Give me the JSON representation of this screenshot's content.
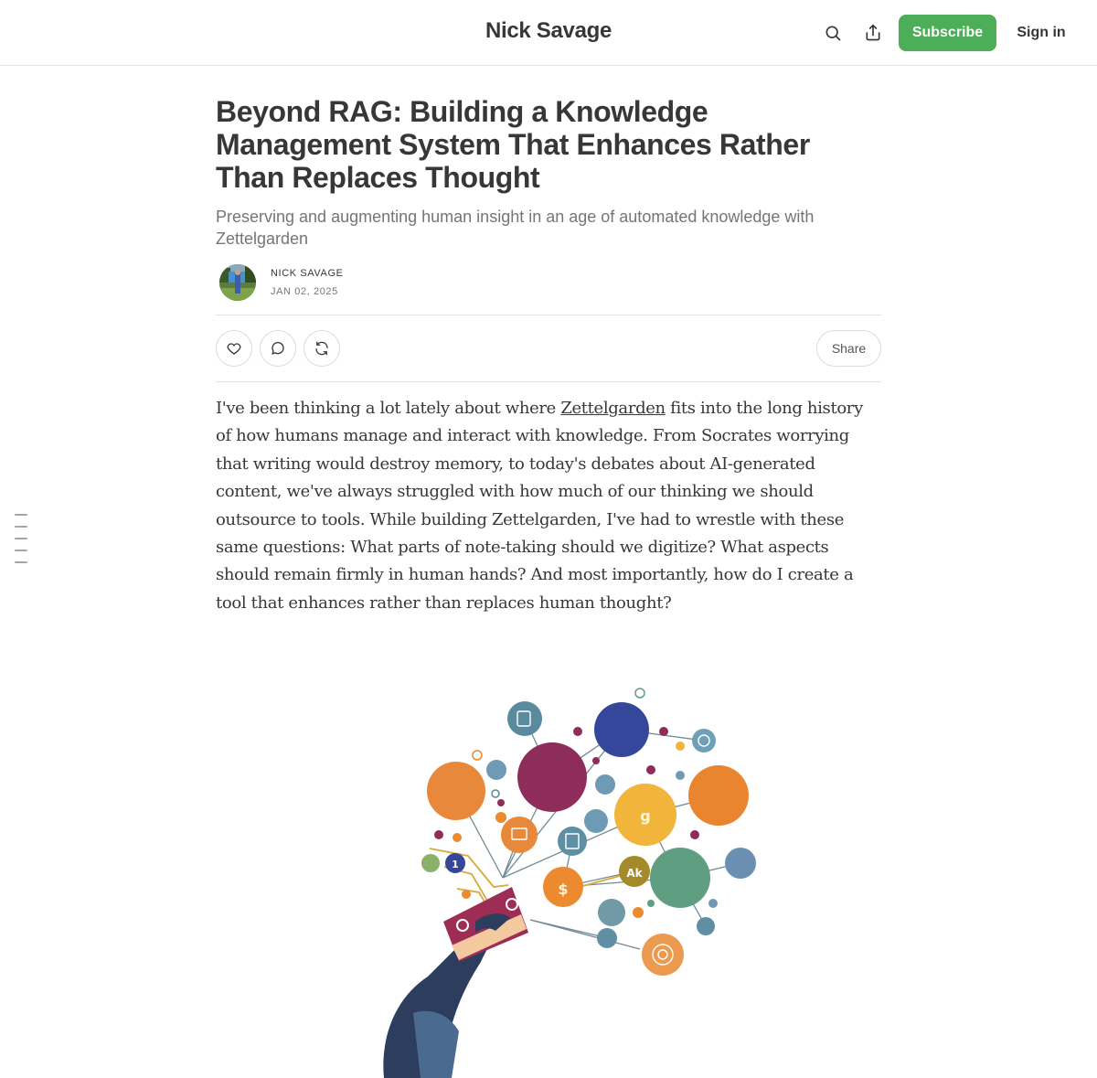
{
  "header": {
    "site_title": "Nick Savage",
    "subscribe_label": "Subscribe",
    "signin_label": "Sign in",
    "accent_color": "#4cae59"
  },
  "post": {
    "title": "Beyond RAG: Building a Knowledge Management System That Enhances Rather Than Replaces Thought",
    "subtitle": "Preserving and augmenting human insight in an age of automated knowledge with Zettelgarden",
    "author": "Nick Savage",
    "date": "Jan 02, 2025"
  },
  "actions": {
    "share_label": "Share",
    "icons": [
      "heart-icon",
      "comment-icon",
      "restack-icon"
    ]
  },
  "body": {
    "before_link": "I've been thinking a lot lately about where ",
    "link_text": "Zettelgarden",
    "after_link": " fits into the long history of how humans manage and interact with knowledge. From Socrates worrying that writing would destroy memory, to today's debates about AI-generated content, we've always struggled with how much of our thinking we should outsource to tools. While building Zettelgarden, I've had to wrestle with these same questions: What parts of note-taking should we digitize? What aspects should remain firmly in human hands? And most importantly, how do I create a tool that enhances rather than replaces human thought?"
  },
  "toc": {
    "item_count": 5
  }
}
